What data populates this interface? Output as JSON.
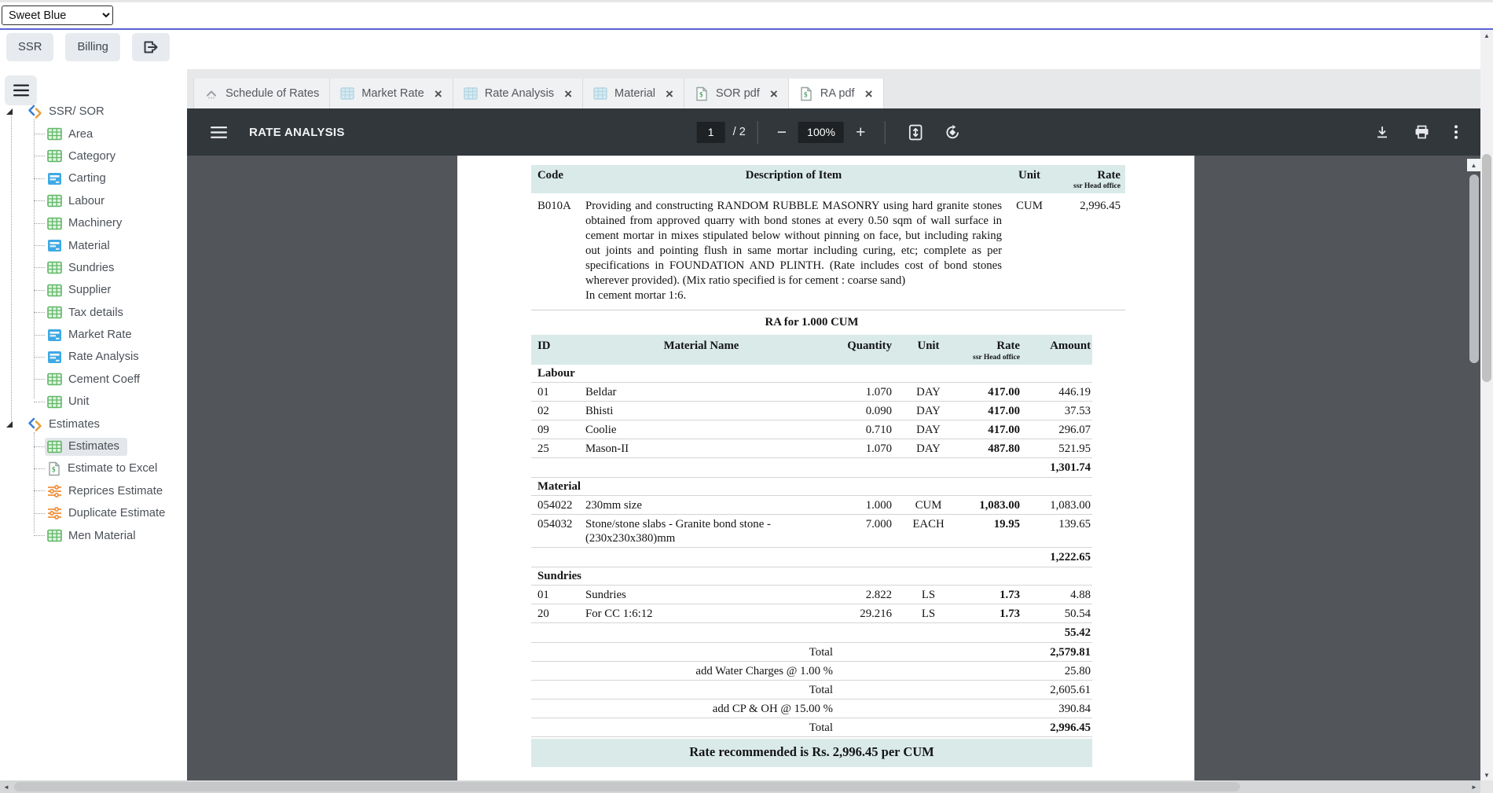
{
  "colors": {
    "accent": "#5964d2",
    "doc_header_bg": "#d9eae9",
    "toolbar_bg": "#32373b",
    "canvas_bg": "#52565a"
  },
  "topbar": {
    "theme_select": {
      "value": "Sweet Blue"
    },
    "nav_buttons": [
      {
        "label": "SSR"
      },
      {
        "label": "Billing"
      }
    ]
  },
  "sidebar": {
    "tree": [
      {
        "label": "SSR/ SOR",
        "children": [
          {
            "label": "Area",
            "icon": "table-green"
          },
          {
            "label": "Category",
            "icon": "table-green"
          },
          {
            "label": "Carting",
            "icon": "card-blue"
          },
          {
            "label": "Labour",
            "icon": "table-green"
          },
          {
            "label": "Machinery",
            "icon": "table-green"
          },
          {
            "label": "Material",
            "icon": "card-blue"
          },
          {
            "label": "Sundries",
            "icon": "table-green"
          },
          {
            "label": "Supplier",
            "icon": "table-green"
          },
          {
            "label": "Tax details",
            "icon": "table-green"
          },
          {
            "label": "Market Rate",
            "icon": "card-blue"
          },
          {
            "label": "Rate Analysis",
            "icon": "card-blue"
          },
          {
            "label": "Cement Coeff",
            "icon": "table-green"
          },
          {
            "label": "Unit",
            "icon": "table-green"
          }
        ]
      },
      {
        "label": "Estimates",
        "children": [
          {
            "label": "Estimates",
            "icon": "table-green",
            "selected": true
          },
          {
            "label": "Estimate to Excel",
            "icon": "doc-dollar"
          },
          {
            "label": "Reprices Estimate",
            "icon": "sliders-orange"
          },
          {
            "label": "Duplicate Estimate",
            "icon": "sliders-orange"
          },
          {
            "label": "Men Material",
            "icon": "table-green"
          }
        ]
      }
    ]
  },
  "tabs": [
    {
      "label": "Schedule of Rates",
      "icon": "caret-up",
      "closable": false,
      "active": false
    },
    {
      "label": "Market Rate",
      "icon": "grid-pale",
      "closable": true,
      "active": false
    },
    {
      "label": "Rate Analysis",
      "icon": "grid-pale",
      "closable": true,
      "active": false
    },
    {
      "label": "Material",
      "icon": "grid-pale",
      "closable": true,
      "active": false
    },
    {
      "label": "SOR pdf",
      "icon": "doc-dollar",
      "closable": true,
      "active": false
    },
    {
      "label": "RA pdf",
      "icon": "doc-dollar",
      "closable": true,
      "active": true
    }
  ],
  "pdf_viewer": {
    "title": "RATE ANALYSIS",
    "page_input": "1",
    "page_count": "/ 2",
    "zoom_level": "100%"
  },
  "document": {
    "item_table": {
      "headers": {
        "code": "Code",
        "description": "Description of Item",
        "unit": "Unit",
        "rate": "Rate",
        "rate_sub": "ssr Head office"
      },
      "row": {
        "code": "B010A",
        "description": "Providing and constructing RANDOM RUBBLE MASONRY using hard granite stones obtained from approved quarry with bond stones at every 0.50 sqm of wall surface in cement mortar in mixes stipulated below without pinning on face, but including raking out joints and pointing flush in same mortar including curing, etc; complete as per specifications in FOUNDATION AND PLINTH. (Rate includes cost of bond stones wherever provided). (Mix ratio specified is for cement : coarse sand)",
        "description_line2": "In cement mortar 1:6.",
        "unit": "CUM",
        "rate": "2,996.45"
      }
    },
    "ra_table": {
      "title": "RA for 1.000 CUM",
      "headers": {
        "id": "ID",
        "name": "Material Name",
        "qty": "Quantity",
        "unit": "Unit",
        "rate": "Rate",
        "rate_sub": "ssr Head office",
        "amount": "Amount"
      },
      "sections": [
        {
          "name": "Labour",
          "rows": [
            [
              "01",
              "Beldar",
              "1.070",
              "DAY",
              "417.00",
              "446.19"
            ],
            [
              "02",
              "Bhisti",
              "0.090",
              "DAY",
              "417.00",
              "37.53"
            ],
            [
              "09",
              "Coolie",
              "0.710",
              "DAY",
              "417.00",
              "296.07"
            ],
            [
              "25",
              "Mason-II",
              "1.070",
              "DAY",
              "487.80",
              "521.95"
            ]
          ],
          "subtotal": "1,301.74"
        },
        {
          "name": "Material",
          "rows": [
            [
              "054022",
              "230mm size",
              "1.000",
              "CUM",
              "1,083.00",
              "1,083.00"
            ],
            [
              "054032",
              "Stone/stone slabs - Granite bond stone - (230x230x380)mm",
              "7.000",
              "EACH",
              "19.95",
              "139.65"
            ]
          ],
          "subtotal": "1,222.65"
        },
        {
          "name": "Sundries",
          "rows": [
            [
              "01",
              "Sundries",
              "2.822",
              "LS",
              "1.73",
              "4.88"
            ],
            [
              "20",
              "For CC 1:6:12",
              "29.216",
              "LS",
              "1.73",
              "50.54"
            ]
          ],
          "subtotal": "55.42"
        }
      ],
      "totals": [
        {
          "label": "Total",
          "value": "2,579.81",
          "bold": true
        },
        {
          "label": "add Water Charges @ 1.00 %",
          "value": "25.80",
          "bold": false
        },
        {
          "label": "Total",
          "value": "2,605.61",
          "bold": false
        },
        {
          "label": "add CP & OH @ 15.00 %",
          "value": "390.84",
          "bold": false
        },
        {
          "label": "Total",
          "value": "2,996.45",
          "bold": true
        }
      ],
      "footer": "Rate recommended is Rs. 2,996.45 per CUM"
    }
  }
}
